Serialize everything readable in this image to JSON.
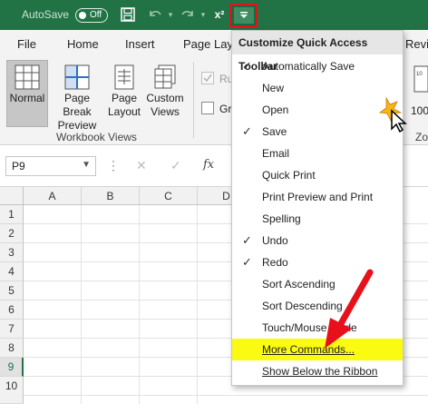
{
  "title_bar": {
    "autosave_label": "AutoSave",
    "autosave_state": "Off",
    "superscript_label": "x²"
  },
  "ribbon_tabs": [
    "File",
    "Home",
    "Insert",
    "Page Layo",
    "Review"
  ],
  "ribbon": {
    "buttons": [
      {
        "label_1": "Normal",
        "label_2": ""
      },
      {
        "label_1": "Page Break",
        "label_2": "Preview"
      },
      {
        "label_1": "Page",
        "label_2": "Layout"
      },
      {
        "label_1": "Custom",
        "label_2": "Views"
      }
    ],
    "group_label": "Workbook Views",
    "checkbox_1": "Ru",
    "checkbox_2": "Gr",
    "zoom_label": "100",
    "zoom_group": "Zo"
  },
  "formula_bar": {
    "name_box": "P9",
    "fx": "fx"
  },
  "grid": {
    "columns": [
      "A",
      "B",
      "C",
      "D"
    ],
    "rows": [
      "1",
      "2",
      "3",
      "4",
      "5",
      "6",
      "7",
      "8",
      "9",
      "10"
    ],
    "active_row": "9"
  },
  "menu": {
    "title": "Customize Quick Access Toolbar",
    "items": [
      {
        "label": "Automatically Save",
        "checked": true
      },
      {
        "label": "New",
        "checked": false
      },
      {
        "label": "Open",
        "checked": false
      },
      {
        "label": "Save",
        "checked": true
      },
      {
        "label": "Email",
        "checked": false
      },
      {
        "label": "Quick Print",
        "checked": false
      },
      {
        "label": "Print Preview and Print",
        "checked": false
      },
      {
        "label": "Spelling",
        "checked": false
      },
      {
        "label": "Undo",
        "checked": true
      },
      {
        "label": "Redo",
        "checked": true
      },
      {
        "label": "Sort Ascending",
        "checked": false
      },
      {
        "label": "Sort Descending",
        "checked": false
      },
      {
        "label": "Touch/Mouse Mode",
        "checked": false
      },
      {
        "label": "More Commands...",
        "checked": false
      },
      {
        "label": "Show Below the Ribbon",
        "checked": false
      }
    ]
  },
  "colors": {
    "excel_green": "#217346",
    "highlight_yellow": "#fbfb12",
    "annotation_red": "#e8101a"
  }
}
